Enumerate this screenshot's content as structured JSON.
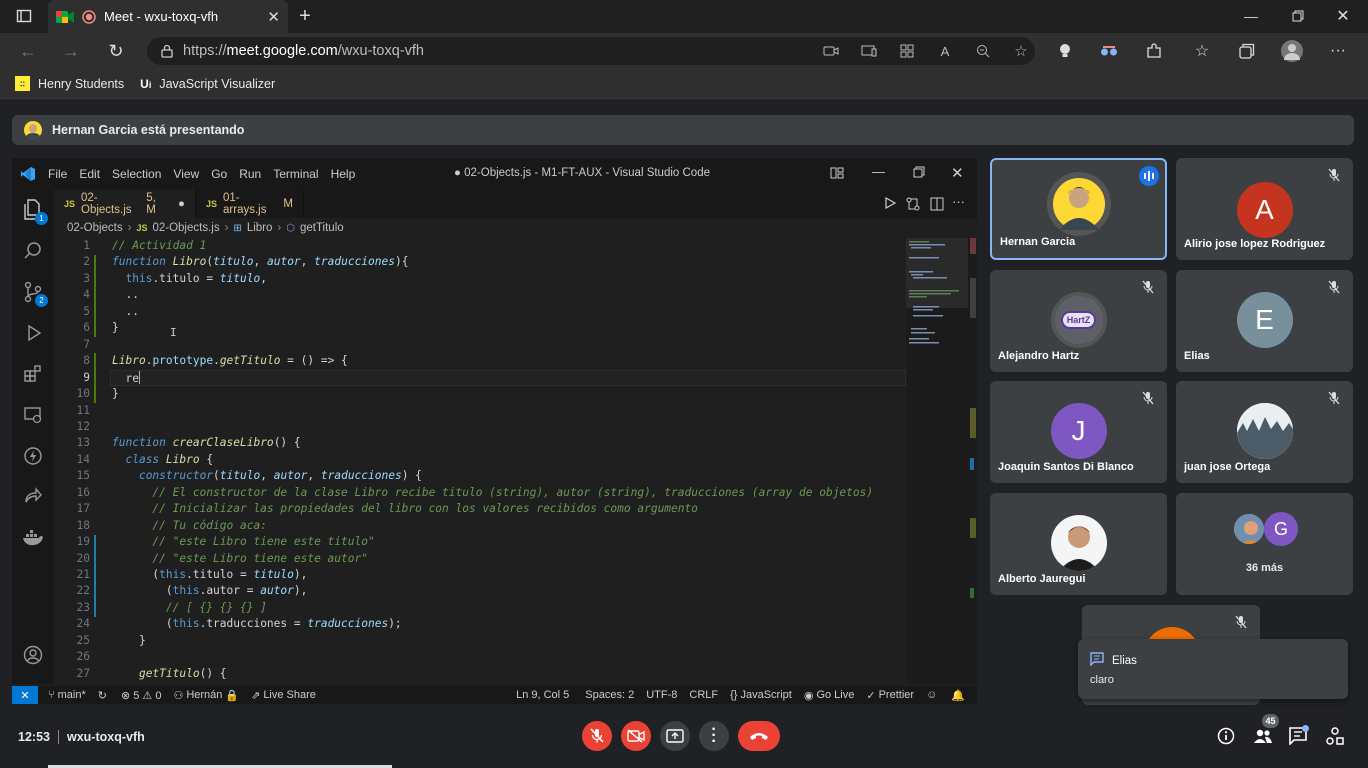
{
  "browser": {
    "tab_title": "Meet - wxu-toxq-vfh",
    "url_prefix": "https://",
    "url_host": "meet.google.com",
    "url_path": "/wxu-toxq-vfh",
    "bookmarks": [
      {
        "label": "Henry Students",
        "icon": "henry-logo"
      },
      {
        "label": "JavaScript Visualizer",
        "icon": "ui-logo"
      }
    ]
  },
  "meet": {
    "presenting_banner": "Hernan Garcia está presentando",
    "meeting_code": "wxu-toxq-vfh",
    "time": "12:53",
    "participant_count": "45",
    "more_label": "36 más",
    "more_avatar_letter": "G",
    "participants": [
      {
        "name": "Hernan Garcia",
        "avatar": "photo",
        "speaking": true
      },
      {
        "name": "Alirio jose lopez Rodriguez",
        "avatar": "A",
        "color": "#c5341f"
      },
      {
        "name": "Alejandro Hartz",
        "avatar": "HartZ",
        "color": "#d9d0e8"
      },
      {
        "name": "Elias",
        "avatar": "E",
        "color": "#78909c"
      },
      {
        "name": "Joaquin Santos Di Blanco",
        "avatar": "J",
        "color": "#7e57c2"
      },
      {
        "name": "juan jose Ortega",
        "avatar": "photo"
      },
      {
        "name": "Alberto Jauregui",
        "avatar": "photo"
      }
    ],
    "chat_toast": {
      "sender": "Elias",
      "message": "claro"
    }
  },
  "vscode": {
    "menu": [
      "File",
      "Edit",
      "Selection",
      "View",
      "Go",
      "Run",
      "Terminal",
      "Help"
    ],
    "title": "● 02-Objects.js - M1-FT-AUX - Visual Studio Code",
    "tabs": [
      {
        "label": "02-Objects.js",
        "badge": "5, M",
        "active": true
      },
      {
        "label": "01-arrays.js",
        "badge": "M",
        "active": false
      }
    ],
    "breadcrumb": [
      "02-Objects",
      "02-Objects.js",
      "Libro",
      "getTitulo"
    ],
    "line_numbers": [
      "1",
      "2",
      "3",
      "4",
      "5",
      "6",
      "7",
      "8",
      "9",
      "10",
      "11",
      "12",
      "13",
      "14",
      "15",
      "16",
      "17",
      "18",
      "19",
      "20",
      "21",
      "22",
      "23",
      "24",
      "25",
      "26",
      "27"
    ],
    "lines": [
      "// Actividad 1",
      "function Libro(titulo, autor, traducciones){",
      "  this.titulo = titulo,",
      "  ..",
      "  ..",
      "}",
      "",
      "Libro.prototype.getTitulo = () => {",
      "  re",
      "}",
      "",
      "",
      "function crearClaseLibro() {",
      "  class Libro {",
      "    constructor(titulo, autor, traducciones) {",
      "      // El constructor de la clase Libro recibe titulo (string), autor (string), traducciones (array de objetos)",
      "      // Inicializar las propiedades del libro con los valores recibidos como argumento",
      "      // Tu código aca:",
      "      // \"este Libro tiene este titulo\"",
      "      // \"este Libro tiene este autor\"",
      "      (this.titulo = titulo),",
      "        (this.autor = autor),",
      "        // [ {} {} {} ]",
      "        (this.traducciones = traducciones);",
      "    }",
      "",
      "    getTitulo() {"
    ],
    "status": {
      "branch": "main*",
      "problems": "⊗ 5 ⚠ 0",
      "user": "Hernán",
      "live_share": "Live Share",
      "position": "Ln 9, Col 5",
      "spaces": "Spaces: 2",
      "encoding": "UTF-8",
      "eol": "CRLF",
      "language": "JavaScript",
      "go_live": "Go Live",
      "prettier": "Prettier"
    },
    "activity_badges": {
      "explorer": "1",
      "scm": "2"
    }
  }
}
